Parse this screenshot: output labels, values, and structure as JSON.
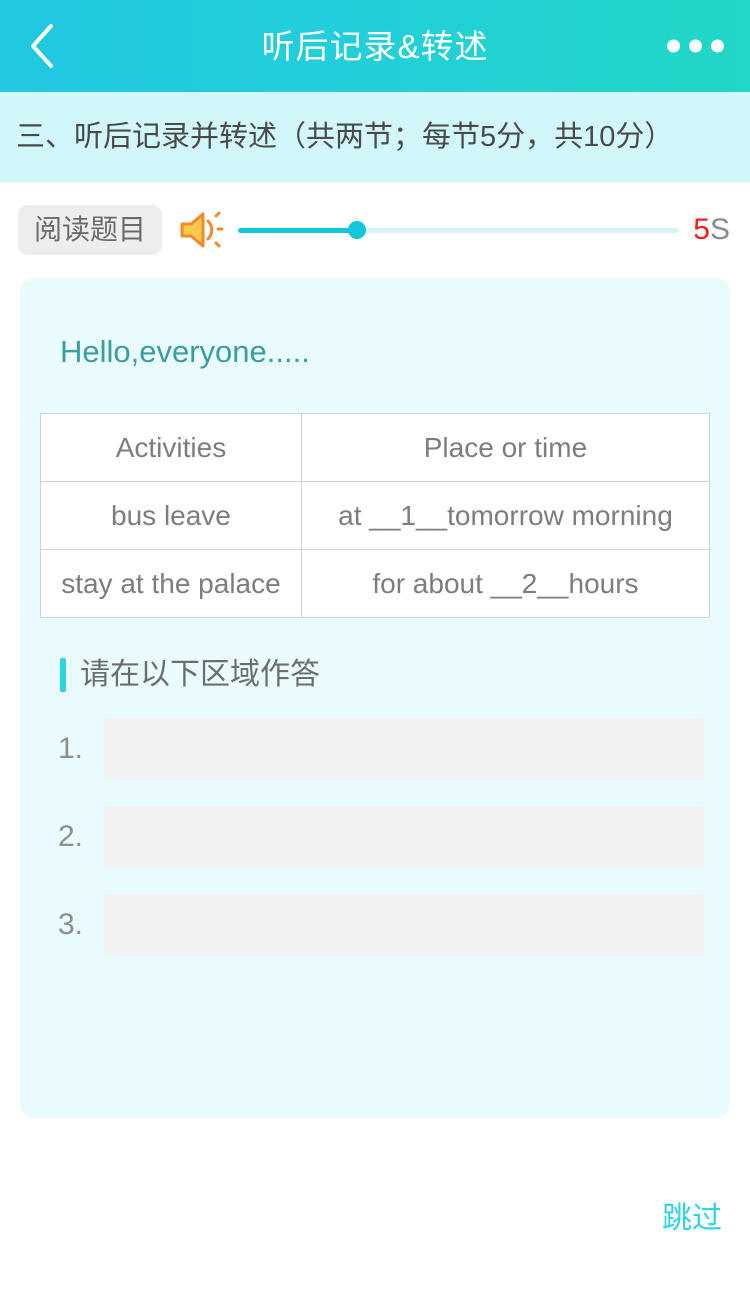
{
  "navbar": {
    "title": "听后记录&转述",
    "back_icon": "chevron-left-icon",
    "more_icon": "more-dots-icon"
  },
  "section": {
    "subtitle": "三、听后记录并转述（共两节；每节5分，共10分）"
  },
  "player": {
    "read_tag_label": "阅读题目",
    "speaker_icon": "speaker-volume-icon",
    "progress_percent": 27,
    "timer_value": "5",
    "timer_unit": "S",
    "accent_color": "#12C6DC",
    "timer_color": "#FF1A1A"
  },
  "content": {
    "greeting": "Hello,everyone.....",
    "table": {
      "headers": [
        "Activities",
        "Place or time"
      ],
      "rows": [
        [
          "bus leave",
          "at __1__tomorrow morning"
        ],
        [
          "stay at the palace",
          "for about __2__hours"
        ]
      ]
    }
  },
  "answer_section": {
    "heading": "请在以下区域作答",
    "items": [
      {
        "number": "1.",
        "value": "",
        "placeholder": ""
      },
      {
        "number": "2.",
        "value": "",
        "placeholder": ""
      },
      {
        "number": "3.",
        "value": "",
        "placeholder": ""
      }
    ]
  },
  "footer": {
    "skip_label": "跳过"
  }
}
